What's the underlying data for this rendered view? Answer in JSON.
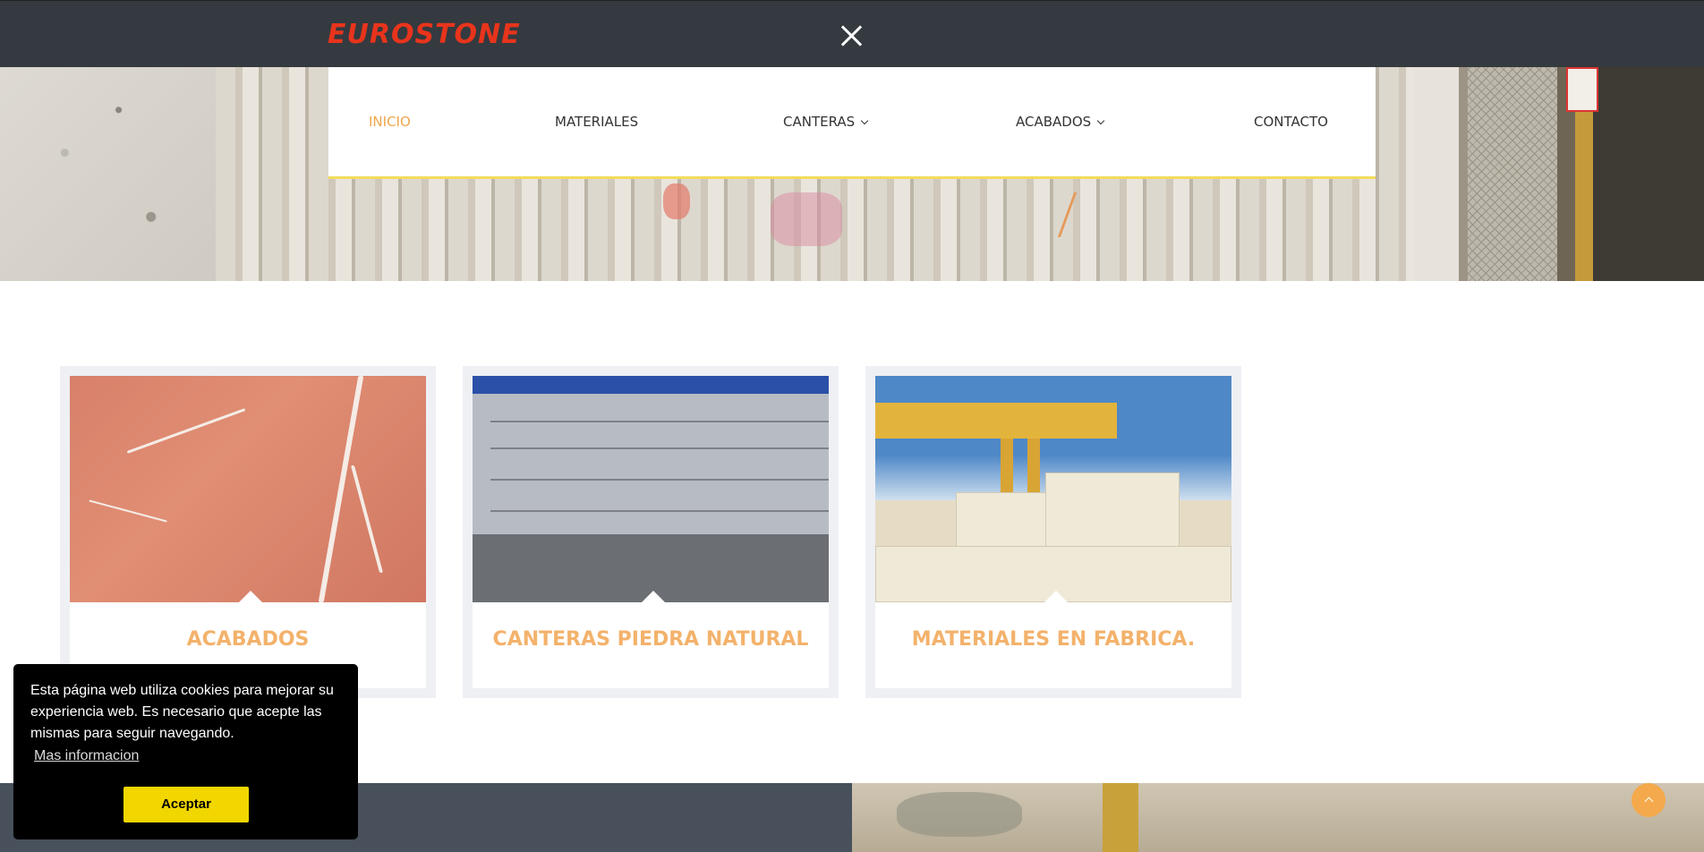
{
  "header": {
    "logo": "EUROSTONE"
  },
  "nav": {
    "items": [
      {
        "label": "INICIO",
        "active": true,
        "has_dropdown": false
      },
      {
        "label": "MATERIALES",
        "active": false,
        "has_dropdown": false
      },
      {
        "label": "CANTERAS",
        "active": false,
        "has_dropdown": true
      },
      {
        "label": "ACABADOS",
        "active": false,
        "has_dropdown": true
      },
      {
        "label": "CONTACTO",
        "active": false,
        "has_dropdown": false
      }
    ]
  },
  "cards": [
    {
      "title": "ACABADOS",
      "image": "red-marble-slab"
    },
    {
      "title": "CANTERAS PIEDRA NATURAL",
      "image": "stone-quarry"
    },
    {
      "title": "MATERIALES EN FABRICA.",
      "image": "factory-crane-blocks"
    }
  ],
  "cookie_banner": {
    "message": "Esta página web utiliza cookies para mejorar su experiencia web. Es necesario que acepte las mismas para seguir navegando.",
    "link_label": "Mas informacion",
    "accept_label": "Aceptar"
  },
  "icons": {
    "close": "close-icon",
    "back_to_top": "chevron-up-icon",
    "dropdown": "chevron-down-icon"
  },
  "colors": {
    "topbar": "#343a3f",
    "logo": "#e8341c",
    "nav_active": "#f0a54b",
    "card_title": "#f3b26b",
    "nav_underline": "#f2dc5d",
    "cookie_button": "#f1d600",
    "back_to_top": "#f4a94c"
  }
}
